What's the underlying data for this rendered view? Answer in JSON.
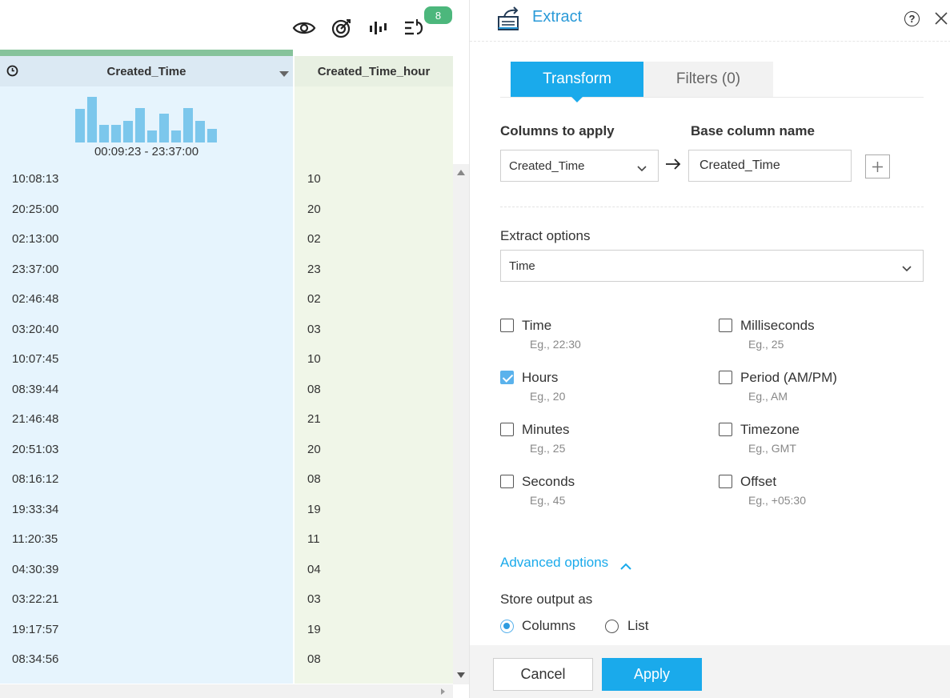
{
  "toolbar": {
    "icons": [
      "eye-icon",
      "target-icon",
      "column-chart-icon",
      "steps-icon"
    ],
    "badge_count": "8"
  },
  "grid": {
    "col1": {
      "header": "Created_Time",
      "icon": "clock-icon"
    },
    "col2": {
      "header": "Created_Time_hour"
    },
    "histogram": {
      "range": "00:09:23 - 23:37:00",
      "bar_levels": [
        0.72,
        0.98,
        0.38,
        0.38,
        0.46,
        0.74,
        0.26,
        0.62,
        0.26,
        0.74,
        0.46,
        0.3
      ]
    },
    "rows": [
      {
        "time": "10:08:13",
        "hour": "10"
      },
      {
        "time": "20:25:00",
        "hour": "20"
      },
      {
        "time": "02:13:00",
        "hour": "02"
      },
      {
        "time": "23:37:00",
        "hour": "23"
      },
      {
        "time": "02:46:48",
        "hour": "02"
      },
      {
        "time": "03:20:40",
        "hour": "03"
      },
      {
        "time": "10:07:45",
        "hour": "10"
      },
      {
        "time": "08:39:44",
        "hour": "08"
      },
      {
        "time": "21:46:48",
        "hour": "21"
      },
      {
        "time": "20:51:03",
        "hour": "20"
      },
      {
        "time": "08:16:12",
        "hour": "08"
      },
      {
        "time": "19:33:34",
        "hour": "19"
      },
      {
        "time": "11:20:35",
        "hour": "11"
      },
      {
        "time": "04:30:39",
        "hour": "04"
      },
      {
        "time": "03:22:21",
        "hour": "03"
      },
      {
        "time": "19:17:57",
        "hour": "19"
      },
      {
        "time": "08:34:56",
        "hour": "08"
      }
    ]
  },
  "panel": {
    "title": "Extract",
    "help_label": "?",
    "tabs": {
      "transform": "Transform",
      "filters": "Filters (0)"
    },
    "columns_to_apply_label": "Columns to apply",
    "base_column_name_label": "Base column name",
    "columns_to_apply_value": "Created_Time",
    "base_column_name_value": "Created_Time",
    "extract_options_label": "Extract options",
    "extract_options_value": "Time",
    "options": {
      "time": {
        "name": "Time",
        "eg": "Eg., 22:30",
        "checked": false
      },
      "hours": {
        "name": "Hours",
        "eg": "Eg., 20",
        "checked": true
      },
      "minutes": {
        "name": "Minutes",
        "eg": "Eg., 25",
        "checked": false
      },
      "seconds": {
        "name": "Seconds",
        "eg": "Eg., 45",
        "checked": false
      },
      "milliseconds": {
        "name": "Milliseconds",
        "eg": "Eg., 25",
        "checked": false
      },
      "period": {
        "name": "Period (AM/PM)",
        "eg": "Eg., AM",
        "checked": false
      },
      "timezone": {
        "name": "Timezone",
        "eg": "Eg., GMT",
        "checked": false
      },
      "offset": {
        "name": "Offset",
        "eg": "Eg., +05:30",
        "checked": false
      }
    },
    "advanced_options": "Advanced options",
    "store_output_label": "Store output as",
    "store_columns": "Columns",
    "store_list": "List",
    "store_selected": "Columns",
    "cancel": "Cancel",
    "apply": "Apply"
  },
  "colors": {
    "accent": "#1aaaeb",
    "title_blue": "#2a9ad8",
    "badge_green": "#4cb77c",
    "col1_bg": "#e6f4fd",
    "col2_bg": "#f0f6e8",
    "histogram_bar": "#7cc7ec"
  }
}
